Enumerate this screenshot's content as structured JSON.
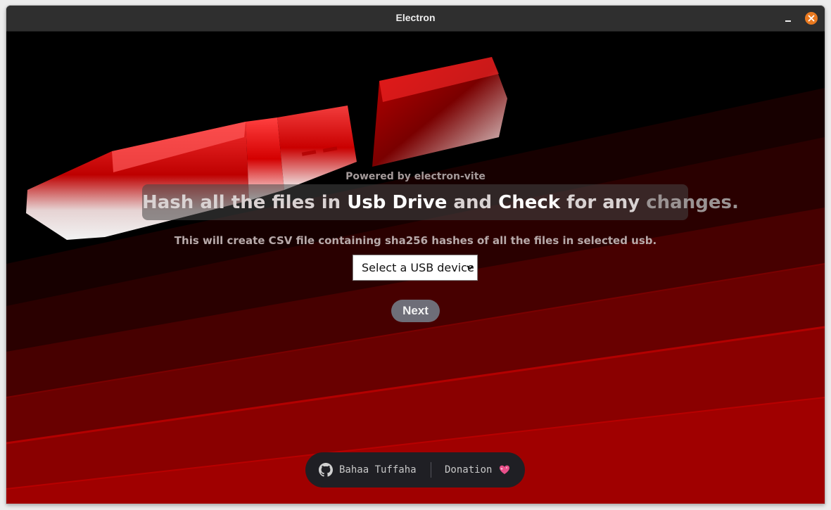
{
  "window": {
    "title": "Electron"
  },
  "hero": {
    "powered_by": "Powered by electron-vite",
    "headline": {
      "part1": "Hash all the files in ",
      "part2": "Usb Drive",
      "part3": " and ",
      "part4": "Check",
      "part5": " for any ",
      "part6": "changes."
    },
    "subtitle": "This will create CSV file containing sha256 hashes of all the files in selected usb."
  },
  "device_select": {
    "selected": "Select a USB device",
    "icon": "chevron-down-icon"
  },
  "next_button": {
    "label": "Next"
  },
  "footer": {
    "github": {
      "label": "Bahaa Tuffaha",
      "icon": "github-icon"
    },
    "donation": {
      "label": "Donation",
      "icon": "sparkling-heart-icon"
    }
  },
  "colors": {
    "accent_red": "#b30000",
    "close_button": "#e9791f",
    "button_gray": "#6e6e78"
  }
}
